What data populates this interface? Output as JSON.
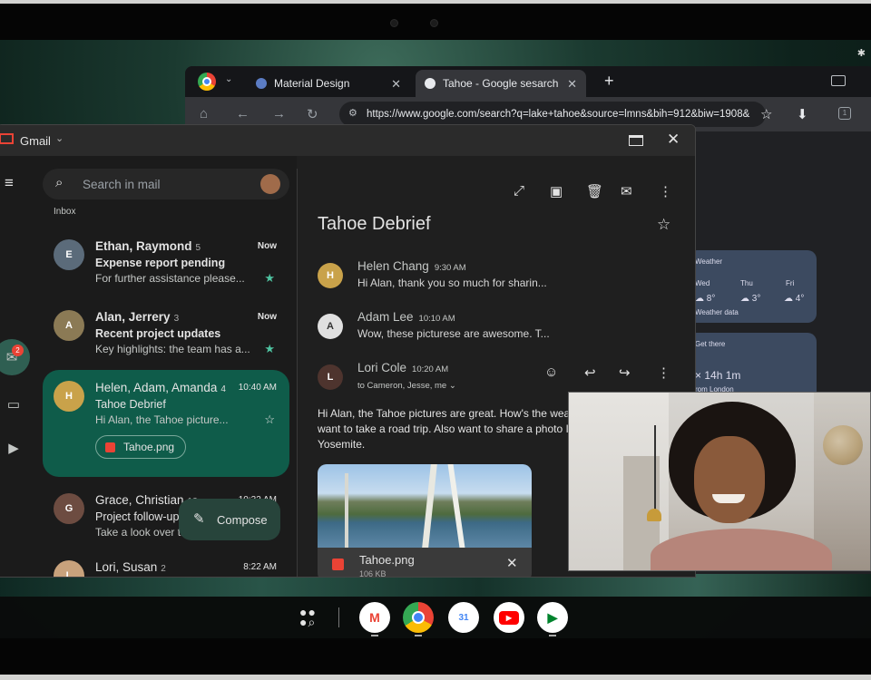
{
  "chrome": {
    "tabs": [
      {
        "label": "Material Design",
        "active": false
      },
      {
        "label": "Tahoe - Google sesarch",
        "active": true
      }
    ],
    "url": "https://www.google.com/search?q=lake+tahoe&source=lmns&bih=912&biw=1908&",
    "cards": {
      "weather_title": "Weather",
      "days": [
        {
          "day": "Wed",
          "temp": "8°"
        },
        {
          "day": "Thu",
          "temp": "3°"
        },
        {
          "day": "Fri",
          "temp": "4°"
        }
      ],
      "weather_data": "Weather data",
      "get_there": "Get there",
      "duration": "14h 1m",
      "from": "rom London"
    }
  },
  "gmail": {
    "app_title": "Gmail",
    "search_placeholder": "Search in mail",
    "inbox_label": "Inbox",
    "chat_badge": "2",
    "compose_label": "Compose",
    "mails": [
      {
        "from": "Ethan, Raymond",
        "count": "5",
        "time": "Now",
        "subject": "Expense report pending",
        "snippet": "For further assistance please...",
        "starred": true
      },
      {
        "from": "Alan, Jerrery",
        "count": "3",
        "time": "Now",
        "subject": "Recent project updates",
        "snippet": "Key highlights: the team has a...",
        "starred": true
      },
      {
        "from": "Helen, Adam, Amanda",
        "count": "4",
        "time": "10:40 AM",
        "subject": "Tahoe Debrief",
        "snippet": "Hi Alan, the Tahoe picture...",
        "starred": false,
        "attachment": "Tahoe.png"
      },
      {
        "from": "Grace, Christian",
        "count": "12",
        "time": "10:32 AM",
        "subject": "Project follow-up",
        "snippet": "Take a look over th",
        "starred": false
      },
      {
        "from": "Lori, Susan",
        "count": "2",
        "time": "8:22 AM",
        "subject": "",
        "snippet": "",
        "starred": false
      }
    ],
    "thread": {
      "title": "Tahoe Debrief",
      "messages": [
        {
          "name": "Helen Chang",
          "time": "9:30 AM",
          "snippet": "Hi Alan, thank you so much for sharin..."
        },
        {
          "name": "Adam Lee",
          "time": "10:10 AM",
          "snippet": "Wow, these picturese are awesome. T..."
        },
        {
          "name": "Lori Cole",
          "time": "10:20 AM",
          "recipients": "to Cameron, Jesse, me"
        }
      ],
      "body": [
        "Hi Alan, the Tahoe pictures are great. How's the weat",
        "want to take a road trip. Also want to share a photo I",
        "Yosemite."
      ],
      "attachment_name": "Tahoe.png",
      "attachment_size": "106 KB"
    }
  },
  "colors": {
    "selected_mail": "#0f5c4a",
    "accent_star": "#4fc3a1",
    "gmail_red": "#ea4335"
  }
}
